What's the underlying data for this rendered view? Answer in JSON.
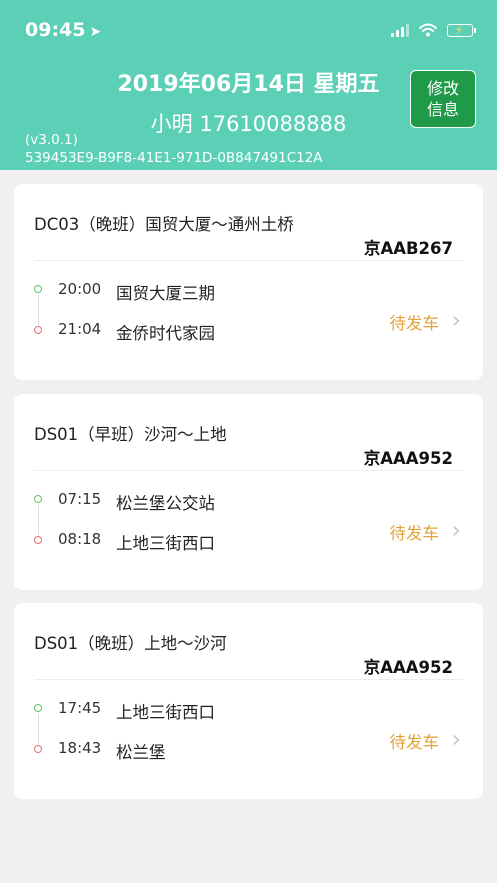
{
  "status_bar": {
    "time": "09:45",
    "location_icon": "location-arrow-icon",
    "signal_icon": "cellular-signal-icon",
    "wifi_icon": "wifi-icon",
    "battery_icon": "battery-charging-icon"
  },
  "header": {
    "date": "2019年06月14日  星期五",
    "user": "小明 17610088888",
    "version": "(v3.0.1)",
    "device_id": "539453E9-B9F8-41E1-971D-0B847491C12A",
    "edit_button": "修改\n信息",
    "background_color": "#5ccfb7",
    "button_color": "#1f9a48"
  },
  "trips": [
    {
      "title": "DC03（晚班）国贸大厦～通州土桥",
      "plate": "京AAB267",
      "start_time": "20:00",
      "start_stop": "国贸大厦三期",
      "end_time": "21:04",
      "end_stop": "金侨时代家园",
      "status": "待发车"
    },
    {
      "title": "DS01（早班）沙河～上地",
      "plate": "京AAA952",
      "start_time": "07:15",
      "start_stop": "松兰堡公交站",
      "end_time": "08:18",
      "end_stop": "上地三街西口",
      "status": "待发车"
    },
    {
      "title": "DS01（晚班）上地～沙河",
      "plate": "京AAA952",
      "start_time": "17:45",
      "start_stop": "上地三街西口",
      "end_time": "18:43",
      "end_stop": "松兰堡",
      "status": "待发车"
    }
  ],
  "colors": {
    "status_text": "#e3a23a",
    "start_dot": "#5cc46a",
    "end_dot": "#e07070"
  }
}
